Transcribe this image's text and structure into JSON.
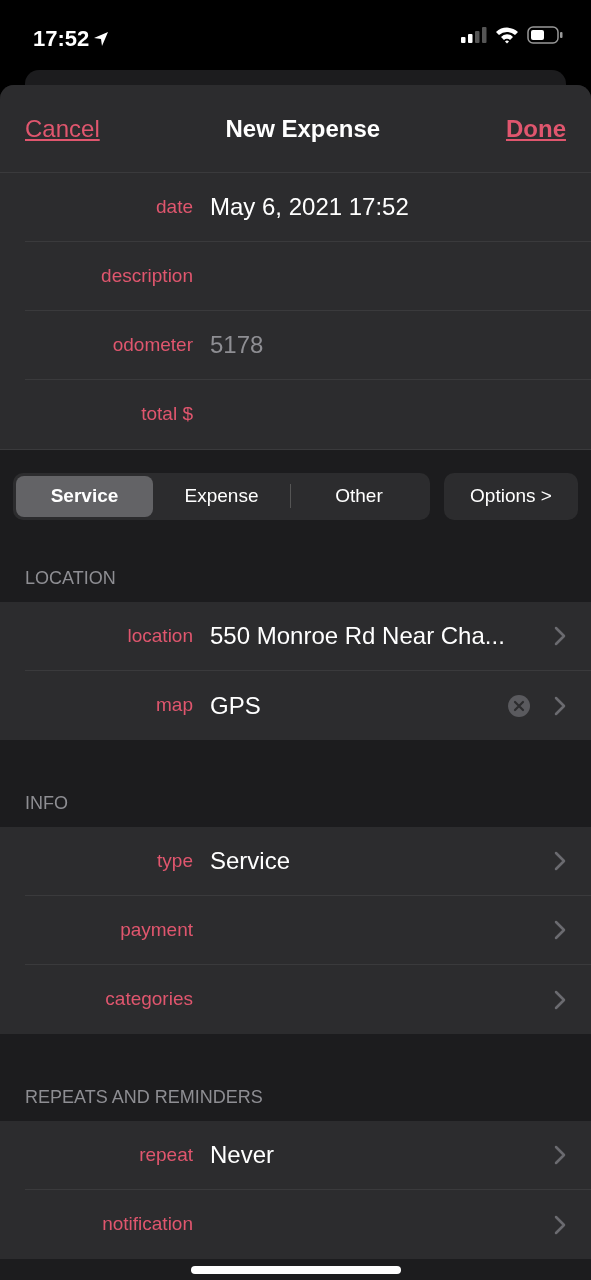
{
  "status_bar": {
    "time": "17:52"
  },
  "nav": {
    "cancel": "Cancel",
    "title": "New Expense",
    "done": "Done"
  },
  "fields": [
    {
      "label": "date",
      "value": "May 6, 2021 17:52"
    },
    {
      "label": "description"
    },
    {
      "label": "odometer",
      "placeholder": "5178"
    },
    {
      "label": "total $"
    }
  ],
  "segments": [
    {
      "label": "Service",
      "selected": true
    },
    {
      "label": "Expense",
      "selected": false
    },
    {
      "label": "Other",
      "selected": false
    }
  ],
  "options_button": "Options >",
  "sections": [
    {
      "header": "LOCATION",
      "rows": [
        {
          "kind": "link",
          "label": "location",
          "value": "550 Monroe Rd Near Cha..."
        },
        {
          "kind": "clearable",
          "label": "map",
          "value": "GPS"
        }
      ]
    },
    {
      "header": "INFO",
      "rows": [
        {
          "kind": "link",
          "label": "type",
          "value": "Service"
        },
        {
          "kind": "link",
          "label": "payment"
        },
        {
          "kind": "link",
          "label": "categories"
        }
      ]
    },
    {
      "header": "REPEATS AND REMINDERS",
      "rows": [
        {
          "kind": "link",
          "label": "repeat",
          "value": "Never"
        },
        {
          "kind": "link",
          "label": "notification"
        }
      ]
    }
  ]
}
